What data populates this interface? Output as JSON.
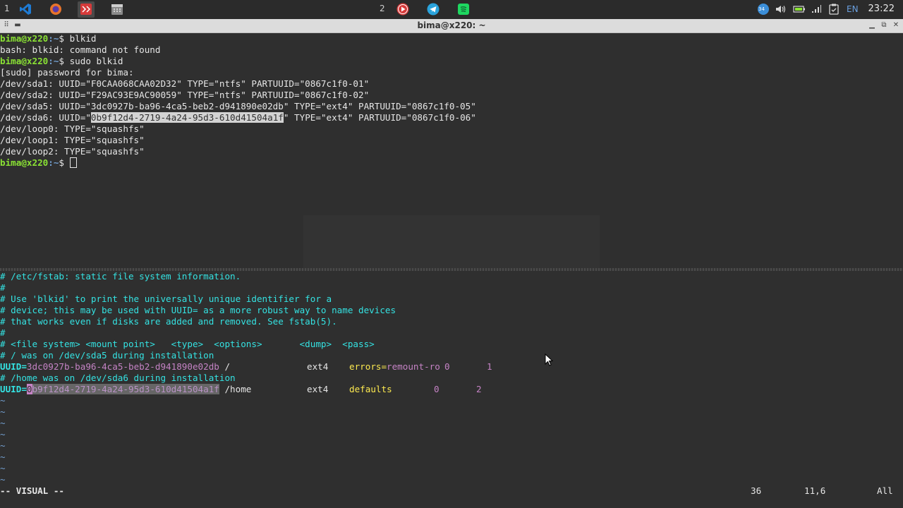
{
  "taskbar": {
    "workspace1": "1",
    "workspace2": "2",
    "apps_left": [
      {
        "name": "vscode-icon",
        "color": "#1f7bd4"
      },
      {
        "name": "firefox-icon",
        "color": "#e8742b"
      },
      {
        "name": "terminal-app-icon",
        "color": "#d63a3a"
      },
      {
        "name": "calendar-icon",
        "color": "#8a8a8a"
      }
    ],
    "apps_right": [
      {
        "name": "media-player-icon",
        "color": "#d63a3a"
      },
      {
        "name": "telegram-icon",
        "color": "#2aa3dc"
      },
      {
        "name": "spotify-icon",
        "color": "#1ed760"
      }
    ],
    "tray": {
      "badge": "34",
      "language": "EN"
    },
    "clock": "23:22"
  },
  "window": {
    "title": "bima@x220: ~"
  },
  "terminal": {
    "prompt_user": "bima@x220",
    "prompt_path": ":~",
    "lines": [
      {
        "type": "cmd",
        "text": "$ blkid"
      },
      {
        "type": "out",
        "text": "bash: blkid: command not found"
      },
      {
        "type": "cmd",
        "text": "$ sudo blkid"
      },
      {
        "type": "out",
        "text": "[sudo] password for bima:"
      },
      {
        "type": "out",
        "text": "/dev/sda1: UUID=\"F0CAA068CAA02D32\" TYPE=\"ntfs\" PARTUUID=\"0867c1f0-01\""
      },
      {
        "type": "out",
        "text": "/dev/sda2: UUID=\"F29AC93E9AC90059\" TYPE=\"ntfs\" PARTUUID=\"0867c1f0-02\""
      },
      {
        "type": "out",
        "text": "/dev/sda5: UUID=\"3dc0927b-ba96-4ca5-beb2-d941890e02db\" TYPE=\"ext4\" PARTUUID=\"0867c1f0-05\""
      },
      {
        "type": "sel",
        "before": "/dev/sda6: UUID=\"",
        "selected": "0b9f12d4-2719-4a24-95d3-610d41504a1f",
        "after": "\" TYPE=\"ext4\" PARTUUID=\"0867c1f0-06\""
      },
      {
        "type": "out",
        "text": "/dev/loop0: TYPE=\"squashfs\""
      },
      {
        "type": "out",
        "text": "/dev/loop1: TYPE=\"squashfs\""
      },
      {
        "type": "out",
        "text": "/dev/loop2: TYPE=\"squashfs\""
      },
      {
        "type": "prompt",
        "text": "$ "
      }
    ]
  },
  "editor": {
    "comments": [
      "# /etc/fstab: static file system information.",
      "#",
      "# Use 'blkid' to print the universally unique identifier for a",
      "# device; this may be used with UUID= as a more robust way to name devices",
      "# that works even if disks are added and removed. See fstab(5).",
      "#",
      "# <file system> <mount point>   <type>  <options>       <dump>  <pass>",
      "# / was on /dev/sda5 during installation"
    ],
    "entry1": {
      "key": "UUID=",
      "uuid": "3dc0927b-ba96-4ca5-beb2-d941890e02db",
      "mount": " /               ",
      "type": "ext4",
      "opt_name": "errors=",
      "opt_value": "remount-ro",
      "dump": "0",
      "pass": "1"
    },
    "comment_home": "# /home was on /dev/sda6 during installation",
    "entry2": {
      "key": "UUID=",
      "cursor_char": "0",
      "uuid_rest": "b9f12d4-2719-4a24-95d3-610d41504a1f",
      "mount": " /home           ",
      "type": "ext4",
      "options": "defaults",
      "dump": "0",
      "pass": "2"
    },
    "tilde": "~",
    "status": {
      "mode": "-- VISUAL --",
      "count": "36",
      "position": "11,6",
      "scroll": "All"
    }
  }
}
